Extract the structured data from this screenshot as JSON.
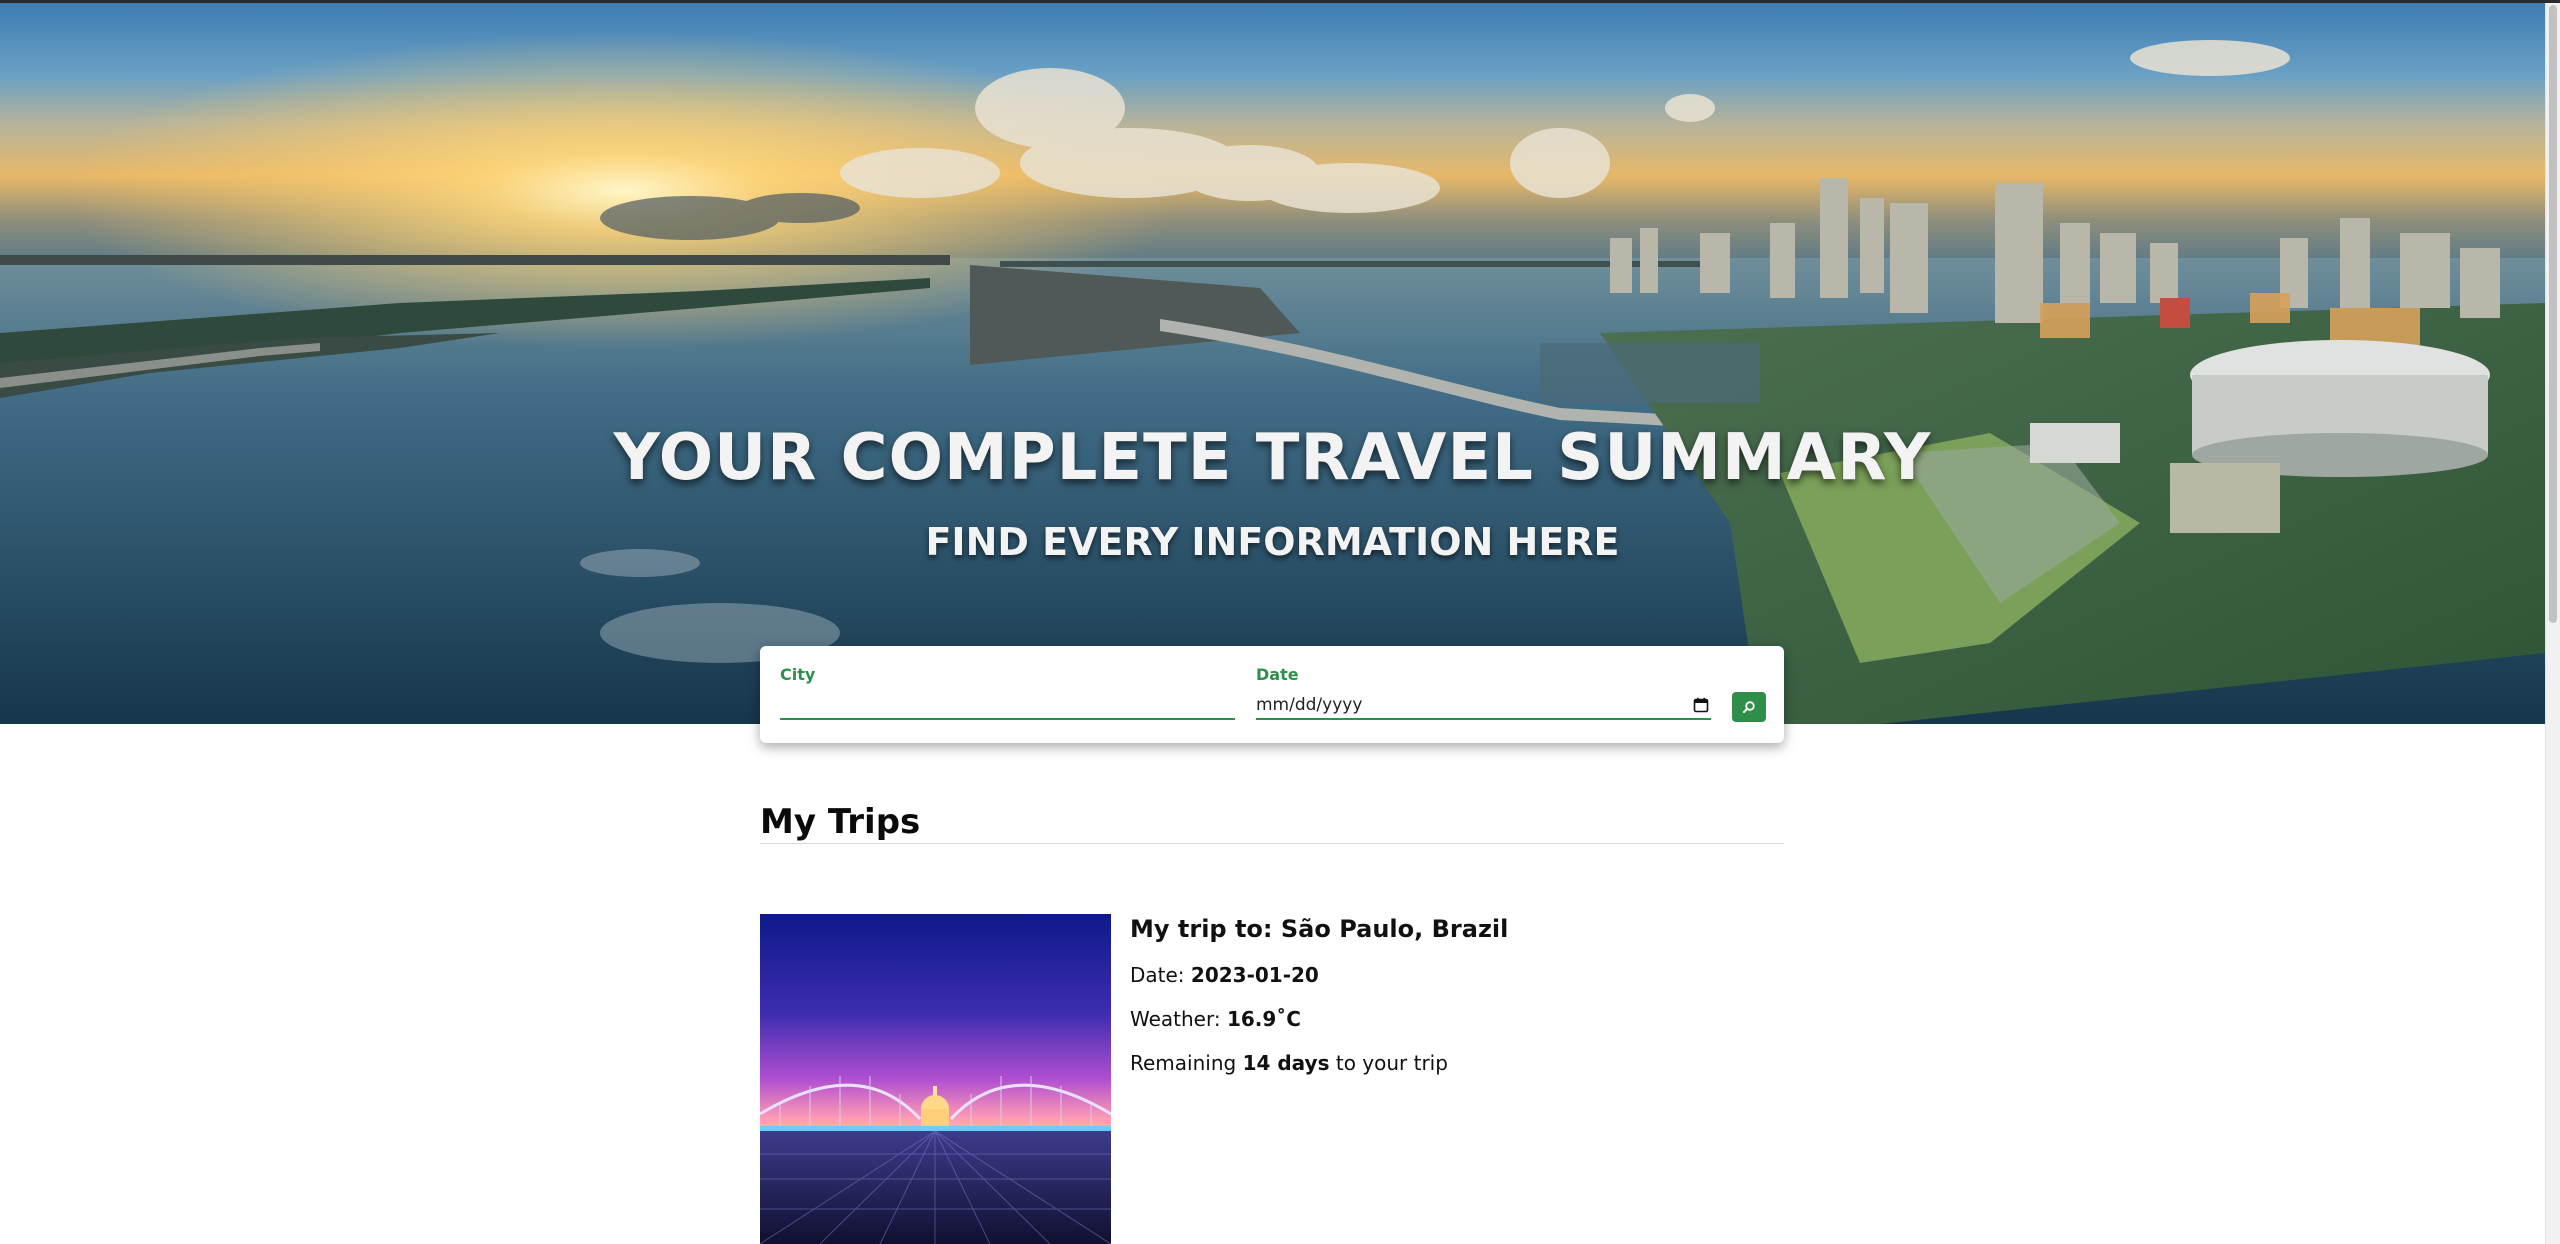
{
  "hero": {
    "title": "YOUR COMPLETE TRAVEL SUMMARY",
    "subtitle": "FIND EVERY INFORMATION HERE",
    "background_image": "city-skyline-waterfront-photo"
  },
  "search": {
    "city_label": "City",
    "city_value": "",
    "city_placeholder": "",
    "date_label": "Date",
    "date_placeholder": "mm/dd/yyyy",
    "button_icon": "search-icon"
  },
  "trips": {
    "heading": "My Trips",
    "items": [
      {
        "image": "illuminated-footbridge-night-photo",
        "title_prefix": "My trip to: ",
        "destination": "São Paulo, Brazil",
        "date_label": "Date: ",
        "date": "2023-01-20",
        "weather_label": "Weather: ",
        "weather": "16.9˚C",
        "remaining_prefix": "Remaining ",
        "remaining_days": "14 days",
        "remaining_suffix": " to your trip"
      }
    ]
  },
  "colors": {
    "accent": "#2f8f4a",
    "hero_text": "#f3f3f3",
    "heading_text": "#0a0a0a"
  }
}
